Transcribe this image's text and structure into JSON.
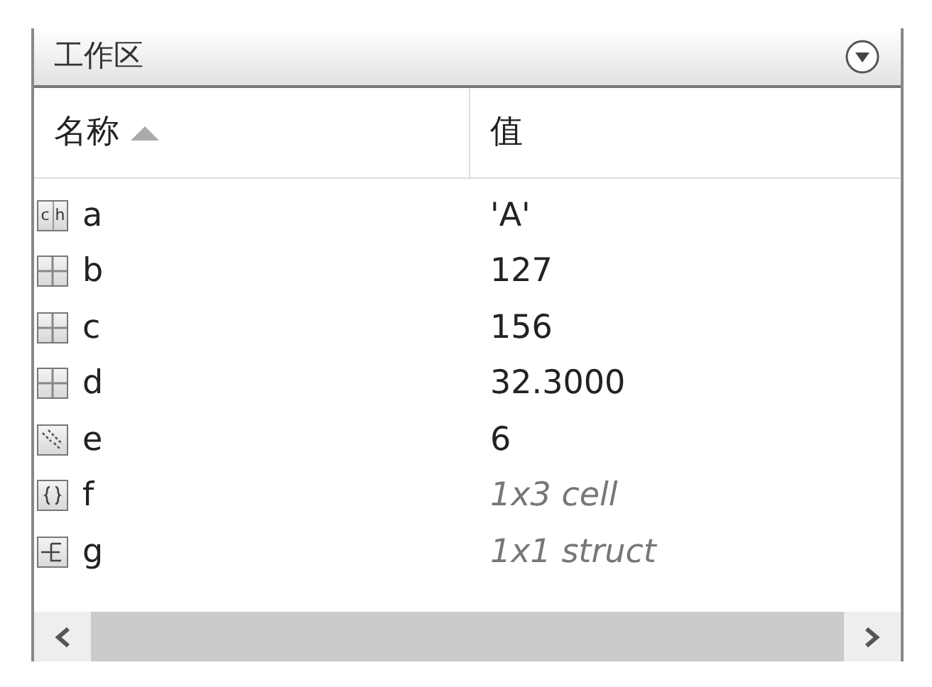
{
  "panel": {
    "title": "工作区"
  },
  "table": {
    "columns": [
      {
        "label": "名称",
        "sorted": true
      },
      {
        "label": "值",
        "sorted": false
      }
    ],
    "rows": [
      {
        "kind": "char",
        "icon_label": [
          "c",
          "h"
        ],
        "name": "a",
        "value": "'A'"
      },
      {
        "kind": "matrix",
        "name": "b",
        "value": "127"
      },
      {
        "kind": "matrix",
        "name": "c",
        "value": "156"
      },
      {
        "kind": "matrix",
        "name": "d",
        "value": "32.3000"
      },
      {
        "kind": "sparse",
        "name": "e",
        "value": "6"
      },
      {
        "kind": "cell",
        "name": "f",
        "value": "1x3 cell"
      },
      {
        "kind": "struct",
        "name": "g",
        "value": "1x1 struct"
      }
    ]
  }
}
